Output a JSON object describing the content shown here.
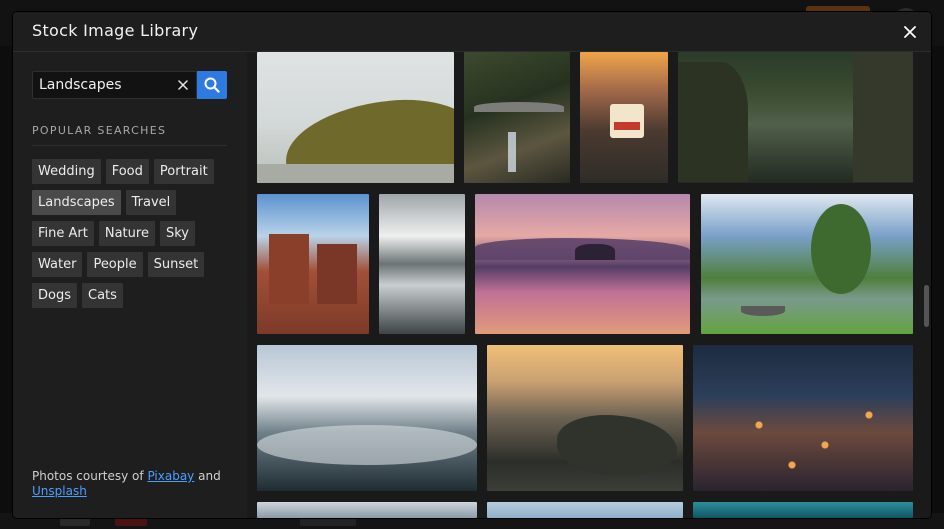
{
  "modal": {
    "title": "Stock Image Library",
    "close_icon": "close-icon"
  },
  "search": {
    "value": "Landscapes",
    "clear_icon": "clear-icon",
    "search_icon": "search-icon"
  },
  "popular": {
    "label": "POPULAR SEARCHES",
    "tags": [
      [
        "Wedding",
        "Food",
        "Portrait"
      ],
      [
        "Landscapes",
        "Travel"
      ],
      [
        "Fine Art",
        "Nature",
        "Sky"
      ],
      [
        "Water",
        "People",
        "Sunset"
      ],
      [
        "Dogs",
        "Cats"
      ]
    ],
    "active": "Landscapes"
  },
  "credits": {
    "prefix": "Photos courtesy of",
    "link1": "Pixabay",
    "middle": "and",
    "link2": "Unsplash"
  },
  "colors": {
    "accent": "#2f7ae0",
    "link": "#4d9eff"
  }
}
